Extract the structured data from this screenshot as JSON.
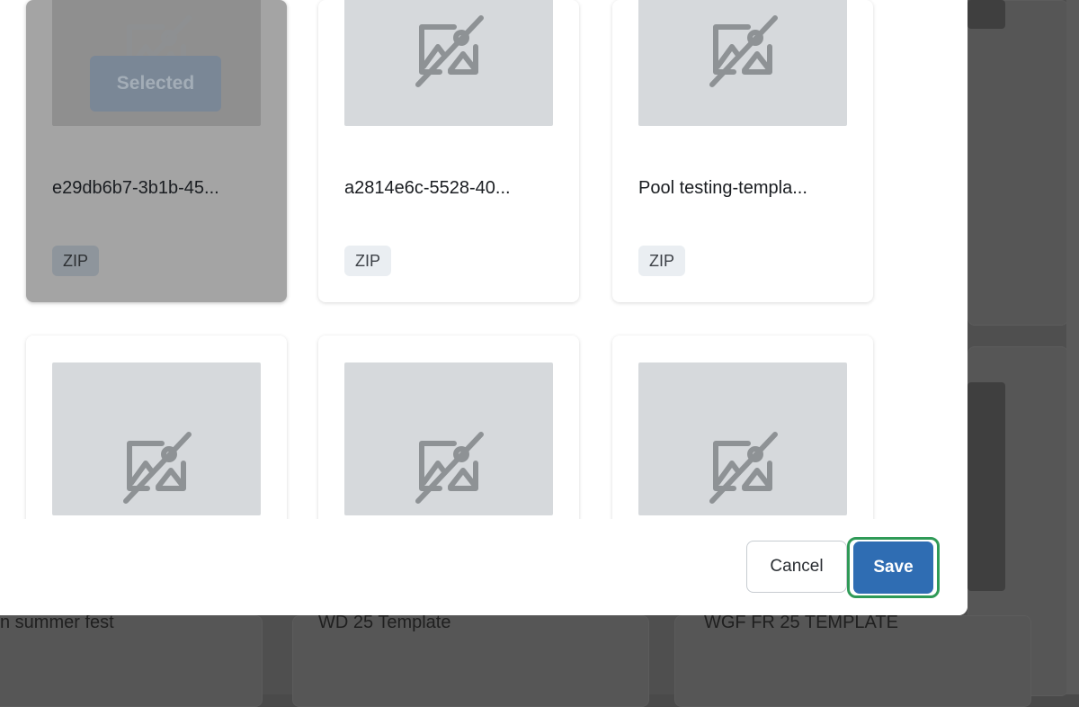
{
  "modal": {
    "cards": [
      {
        "title": "e29db6b7-3b1b-45...",
        "badge": "ZIP",
        "selected": true,
        "selected_label": "Selected",
        "icon": "image-off-icon"
      },
      {
        "title": "a2814e6c-5528-40...",
        "badge": "ZIP",
        "selected": false,
        "icon": "image-off-icon"
      },
      {
        "title": "Pool testing-templa...",
        "badge": "ZIP",
        "selected": false,
        "icon": "image-off-icon"
      },
      {
        "title": "",
        "badge": "",
        "selected": false,
        "icon": "image-off-icon"
      },
      {
        "title": "",
        "badge": "",
        "selected": false,
        "icon": "image-off-icon"
      },
      {
        "title": "",
        "badge": "",
        "selected": false,
        "icon": "image-off-icon"
      }
    ],
    "footer": {
      "cancel_label": "Cancel",
      "save_label": "Save"
    }
  },
  "background": {
    "templates": [
      "n summer fest",
      "WD 25 Template",
      "WGF FR 25 TEMPLATE"
    ]
  },
  "colors": {
    "primary": "#2f6db3",
    "focus_ring": "#2f9a57",
    "placeholder": "#d6d9dc",
    "overlay": "#4f4f4f"
  }
}
